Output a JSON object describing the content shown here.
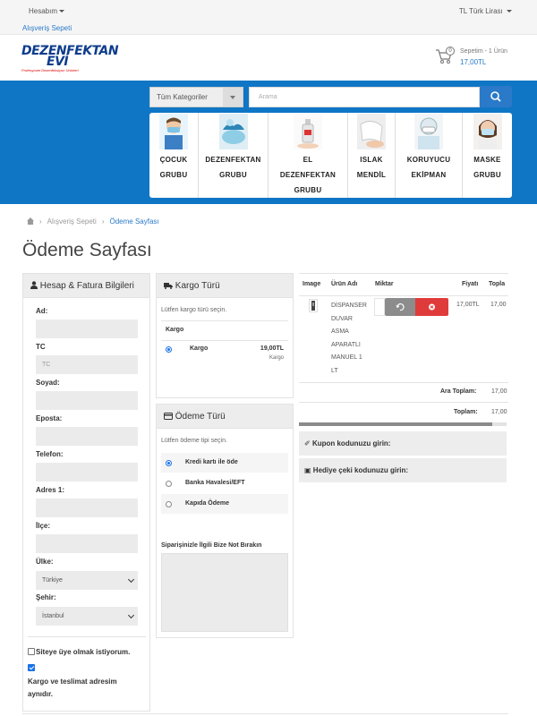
{
  "topbar": {
    "account_label": "Hesabım",
    "currency_label": "TL Türk Lirası",
    "cart_link": "Alışveriş Sepeti"
  },
  "header": {
    "logo_text": "DEZENFEKTAN EVİ",
    "logo_tagline": "Profesyonel Dezenfeksiyon Ürünleri",
    "cart_count": "0",
    "cart_title": "Sepetim - 1 Ürün",
    "cart_total": "17,00TL"
  },
  "search": {
    "category_select": "Tüm Kategoriler",
    "placeholder": "Arama"
  },
  "categories": [
    {
      "line1": "ÇOCUK",
      "line2": "GRUBU"
    },
    {
      "line1": "DEZENFEKTAN",
      "line2": "GRUBU"
    },
    {
      "line1": "EL",
      "line2": "DEZENFEKTAN",
      "line3": "GRUBU"
    },
    {
      "line1": "ISLAK",
      "line2": "MENDİL"
    },
    {
      "line1": "KORUYUCU",
      "line2": "EKİPMAN"
    },
    {
      "line1": "MASKE",
      "line2": "GRUBU"
    }
  ],
  "breadcrumb": {
    "cart": "Alışveriş Sepeti",
    "current": "Ödeme Sayfası"
  },
  "page_title": "Ödeme Sayfası",
  "account": {
    "heading": "Hesap & Fatura Bilgileri",
    "labels": {
      "ad": "Ad:",
      "tc": "TC",
      "soyad": "Soyad:",
      "eposta": "Eposta:",
      "telefon": "Telefon:",
      "adres": "Adres 1:",
      "ilce": "İlçe:",
      "ulke": "Ülke:",
      "sehir": "Şehir:"
    },
    "tc_placeholder": "TC",
    "ulke_value": "Türkiye",
    "sehir_value": "İstanbul",
    "member_check": "Siteye üye olmak istiyorum.",
    "same_address_check": "Kargo ve teslimat adresim aynıdır."
  },
  "kargo": {
    "heading": "Kargo Türü",
    "hint": "Lütfen kargo türü seçin.",
    "group": "Kargo",
    "option_name": "Kargo",
    "option_price": "19,00TL",
    "option_sub": "Kargo"
  },
  "odeme": {
    "heading": "Ödeme Türü",
    "hint": "Lütfen ödeme tipi seçin.",
    "options": [
      "Kredi kartı ile öde",
      "Banka Havalesi/EFT",
      "Kapıda Ödeme"
    ],
    "note_label": "Siparişinizle İlgili Bize Not Bırakın"
  },
  "cart": {
    "headers": {
      "image": "Image",
      "name": "Ürün Adı",
      "qty": "Miktar",
      "price": "Fiyatı",
      "total": "Topla"
    },
    "item_name": [
      "DİSPANSER",
      "DUVAR",
      "ASMA",
      "APARATLI",
      "MANUEL 1",
      "LT"
    ],
    "item_price": "17,00TL",
    "item_total": "17,00",
    "subtotal_label": "Ara Toplam:",
    "subtotal_value": "17,00",
    "total_label": "Toplam:",
    "total_value": "17,00"
  },
  "coupon": {
    "coupon_label": "Kupon kodunuzu girin:",
    "gift_label": "Hediye çeki kodunuzu girin:"
  }
}
